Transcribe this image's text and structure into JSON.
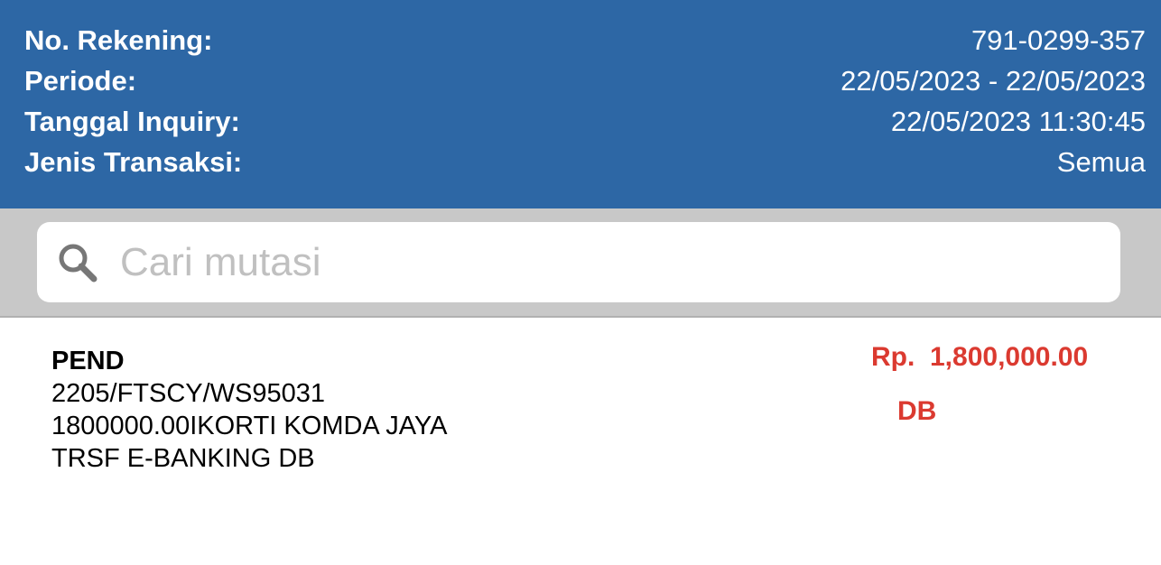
{
  "header": {
    "rows": [
      {
        "label": "No. Rekening:",
        "value": "791-0299-357"
      },
      {
        "label": "Periode:",
        "value": "22/05/2023 - 22/05/2023"
      },
      {
        "label": "Tanggal Inquiry:",
        "value": "22/05/2023 11:30:45"
      },
      {
        "label": "Jenis Transaksi:",
        "value": "Semua"
      }
    ]
  },
  "search": {
    "placeholder": "Cari mutasi",
    "icon": "search-icon"
  },
  "transactions": [
    {
      "title": "PEND",
      "lines": [
        "2205/FTSCY/WS95031",
        "1800000.00IKORTI KOMDA JAYA",
        "TRSF E-BANKING DB"
      ],
      "amount": "Rp.  1,800,000.00",
      "type": "DB",
      "color": "#db3a30"
    }
  ]
}
